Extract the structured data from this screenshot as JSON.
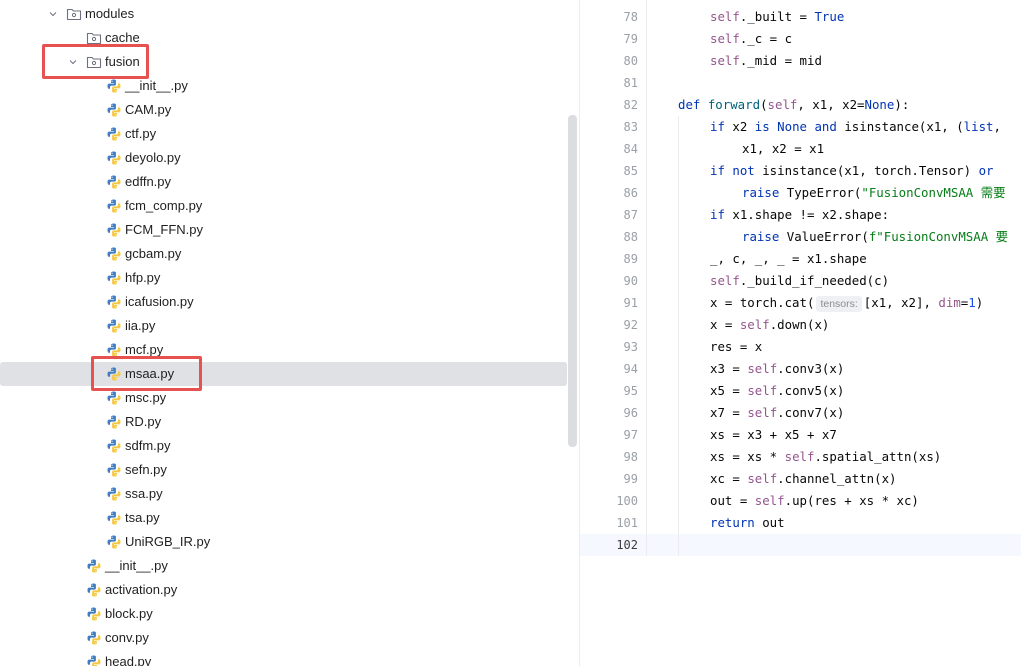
{
  "tree": {
    "rows": [
      {
        "label": "modules",
        "type": "folder",
        "depth": 0,
        "expanded": true
      },
      {
        "label": "cache",
        "type": "folder",
        "depth": 1
      },
      {
        "label": "fusion",
        "type": "folder",
        "depth": 1,
        "expanded": true,
        "highlighted": true
      },
      {
        "label": "__init__.py",
        "type": "py",
        "depth": 2
      },
      {
        "label": "CAM.py",
        "type": "py",
        "depth": 2
      },
      {
        "label": "ctf.py",
        "type": "py",
        "depth": 2
      },
      {
        "label": "deyolo.py",
        "type": "py",
        "depth": 2
      },
      {
        "label": "edffn.py",
        "type": "py",
        "depth": 2
      },
      {
        "label": "fcm_comp.py",
        "type": "py",
        "depth": 2
      },
      {
        "label": "FCM_FFN.py",
        "type": "py",
        "depth": 2
      },
      {
        "label": "gcbam.py",
        "type": "py",
        "depth": 2
      },
      {
        "label": "hfp.py",
        "type": "py",
        "depth": 2
      },
      {
        "label": "icafusion.py",
        "type": "py",
        "depth": 2
      },
      {
        "label": "iia.py",
        "type": "py",
        "depth": 2
      },
      {
        "label": "mcf.py",
        "type": "py",
        "depth": 2
      },
      {
        "label": "msaa.py",
        "type": "py",
        "depth": 2,
        "selected": true,
        "highlighted": true
      },
      {
        "label": "msc.py",
        "type": "py",
        "depth": 2
      },
      {
        "label": "RD.py",
        "type": "py",
        "depth": 2
      },
      {
        "label": "sdfm.py",
        "type": "py",
        "depth": 2
      },
      {
        "label": "sefn.py",
        "type": "py",
        "depth": 2
      },
      {
        "label": "ssa.py",
        "type": "py",
        "depth": 2
      },
      {
        "label": "tsa.py",
        "type": "py",
        "depth": 2
      },
      {
        "label": "UniRGB_IR.py",
        "type": "py",
        "depth": 2
      },
      {
        "label": "__init__.py",
        "type": "py",
        "depth": 1
      },
      {
        "label": "activation.py",
        "type": "py",
        "depth": 1
      },
      {
        "label": "block.py",
        "type": "py",
        "depth": 1
      },
      {
        "label": "conv.py",
        "type": "py",
        "depth": 1
      },
      {
        "label": "head.py",
        "type": "py",
        "depth": 1
      }
    ]
  },
  "editor": {
    "current_line": 102,
    "lines": [
      {
        "n": 78,
        "indent": 2,
        "t": [
          {
            "c": "slf",
            "s": "self"
          },
          {
            "s": "._built = "
          },
          {
            "c": "kw",
            "s": "True"
          }
        ]
      },
      {
        "n": 79,
        "indent": 2,
        "t": [
          {
            "c": "slf",
            "s": "self"
          },
          {
            "s": "._c = c"
          }
        ]
      },
      {
        "n": 80,
        "indent": 2,
        "t": [
          {
            "c": "slf",
            "s": "self"
          },
          {
            "s": "._mid = mid"
          }
        ]
      },
      {
        "n": 81,
        "indent": 0,
        "t": []
      },
      {
        "n": 82,
        "indent": 1,
        "t": [
          {
            "c": "kw",
            "s": "def "
          },
          {
            "c": "fn",
            "s": "forward"
          },
          {
            "s": "("
          },
          {
            "c": "slf",
            "s": "self"
          },
          {
            "s": ", x1, x2="
          },
          {
            "c": "kw",
            "s": "None"
          },
          {
            "s": "):"
          }
        ]
      },
      {
        "n": 83,
        "indent": 2,
        "t": [
          {
            "c": "kw",
            "s": "if "
          },
          {
            "s": "x2 "
          },
          {
            "c": "kw",
            "s": "is None and "
          },
          {
            "s": "isinstance(x1, ("
          },
          {
            "c": "kw",
            "s": "list"
          },
          {
            "s": ","
          }
        ]
      },
      {
        "n": 84,
        "indent": 3,
        "t": [
          {
            "s": "x1, x2 = x1"
          }
        ]
      },
      {
        "n": 85,
        "indent": 2,
        "t": [
          {
            "c": "kw",
            "s": "if not "
          },
          {
            "s": "isinstance(x1, torch.Tensor) "
          },
          {
            "c": "kw",
            "s": "or"
          }
        ]
      },
      {
        "n": 86,
        "indent": 3,
        "t": [
          {
            "c": "kw",
            "s": "raise "
          },
          {
            "s": "TypeError("
          },
          {
            "c": "str",
            "s": "\"FusionConvMSAA 需要"
          }
        ]
      },
      {
        "n": 87,
        "indent": 2,
        "t": [
          {
            "c": "kw",
            "s": "if "
          },
          {
            "s": "x1.shape != x2.shape:"
          }
        ]
      },
      {
        "n": 88,
        "indent": 3,
        "t": [
          {
            "c": "kw",
            "s": "raise "
          },
          {
            "s": "ValueError("
          },
          {
            "c": "str",
            "s": "f\"FusionConvMSAA 要"
          }
        ]
      },
      {
        "n": 89,
        "indent": 2,
        "t": [
          {
            "s": "_, c, _, _ = x1.shape"
          }
        ]
      },
      {
        "n": 90,
        "indent": 2,
        "t": [
          {
            "c": "slf",
            "s": "self"
          },
          {
            "s": "._build_if_needed(c)"
          }
        ]
      },
      {
        "n": 91,
        "indent": 2,
        "t": [
          {
            "s": "x = torch.cat("
          },
          {
            "c": "hint",
            "s": "tensors:"
          },
          {
            "s": "[x1, x2], "
          },
          {
            "c": "slf",
            "s": "dim"
          },
          {
            "s": "="
          },
          {
            "c": "nm",
            "s": "1"
          },
          {
            "s": ")"
          }
        ]
      },
      {
        "n": 92,
        "indent": 2,
        "t": [
          {
            "s": "x = "
          },
          {
            "c": "slf",
            "s": "self"
          },
          {
            "s": ".down(x)"
          }
        ]
      },
      {
        "n": 93,
        "indent": 2,
        "t": [
          {
            "s": "res = x"
          }
        ]
      },
      {
        "n": 94,
        "indent": 2,
        "t": [
          {
            "s": "x3 = "
          },
          {
            "c": "slf",
            "s": "self"
          },
          {
            "s": ".conv3(x)"
          }
        ]
      },
      {
        "n": 95,
        "indent": 2,
        "t": [
          {
            "s": "x5 = "
          },
          {
            "c": "slf",
            "s": "self"
          },
          {
            "s": ".conv5(x)"
          }
        ]
      },
      {
        "n": 96,
        "indent": 2,
        "t": [
          {
            "s": "x7 = "
          },
          {
            "c": "slf",
            "s": "self"
          },
          {
            "s": ".conv7(x)"
          }
        ]
      },
      {
        "n": 97,
        "indent": 2,
        "t": [
          {
            "s": "xs = x3 + x5 + x7"
          }
        ]
      },
      {
        "n": 98,
        "indent": 2,
        "t": [
          {
            "s": "xs = xs * "
          },
          {
            "c": "slf",
            "s": "self"
          },
          {
            "s": ".spatial_attn(xs)"
          }
        ]
      },
      {
        "n": 99,
        "indent": 2,
        "t": [
          {
            "s": "xc = "
          },
          {
            "c": "slf",
            "s": "self"
          },
          {
            "s": ".channel_attn(x)"
          }
        ]
      },
      {
        "n": 100,
        "indent": 2,
        "t": [
          {
            "s": "out = "
          },
          {
            "c": "slf",
            "s": "self"
          },
          {
            "s": ".up(res + xs * xc)"
          }
        ]
      },
      {
        "n": 101,
        "indent": 2,
        "t": [
          {
            "c": "kw",
            "s": "return "
          },
          {
            "s": "out"
          }
        ]
      },
      {
        "n": 102,
        "indent": 0,
        "t": []
      }
    ]
  },
  "colors": {
    "highlight": "#e5524f",
    "selection": "#dfe1e5",
    "python_blue": "#3f7cc0",
    "python_yellow": "#f3c94a"
  },
  "icons": {
    "folder": "folder-icon",
    "python": "python-file-icon",
    "chevron": "chevron-down-icon"
  }
}
